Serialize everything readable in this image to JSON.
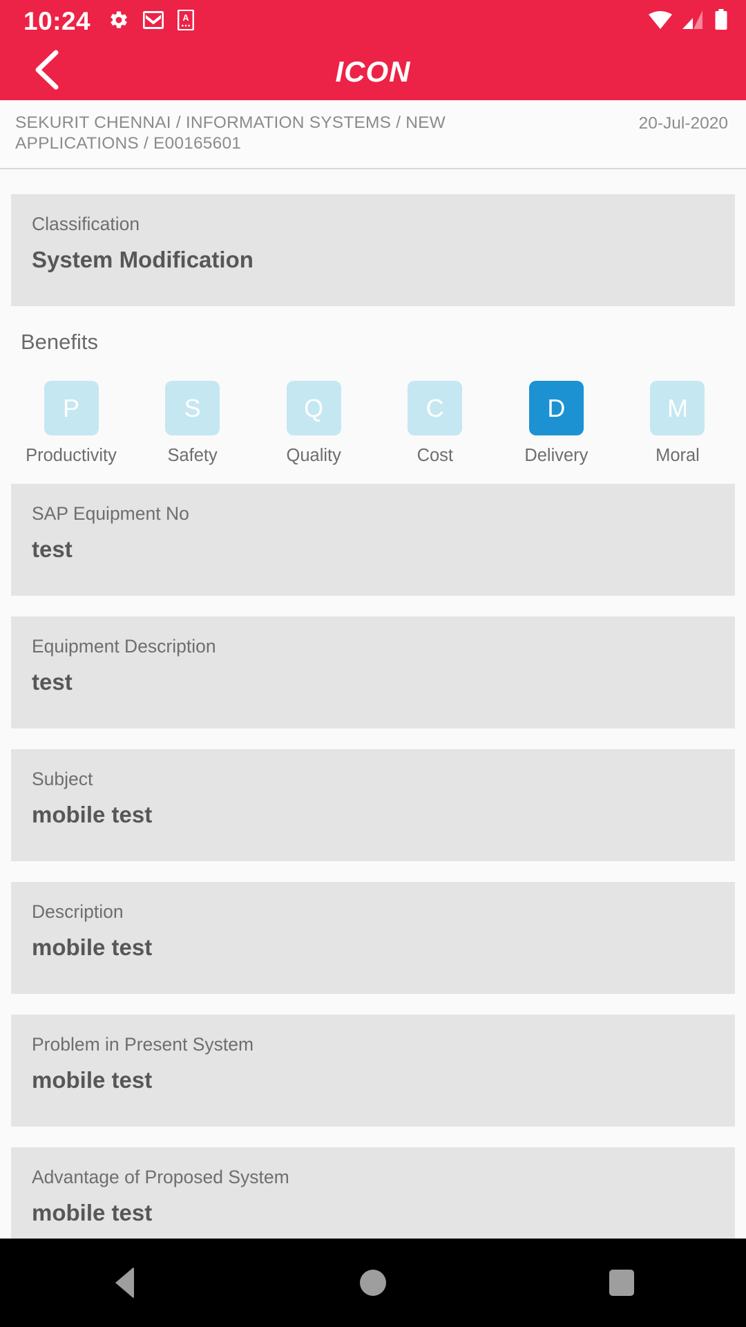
{
  "status_bar": {
    "time": "10:24",
    "left_icons": [
      "gear-icon",
      "gmail-icon",
      "app-a-icon"
    ],
    "right_icons": [
      "wifi-icon",
      "signal-icon",
      "battery-icon"
    ]
  },
  "app_bar": {
    "title": "ICON",
    "back_icon": "chevron-left-icon",
    "background_color": "#ED2247"
  },
  "breadcrumb": {
    "path": "SEKURIT CHENNAI / INFORMATION SYSTEMS  / NEW APPLICATIONS / E00165601",
    "date": "20-Jul-2020"
  },
  "classification": {
    "label": "Classification",
    "value": "System Modification"
  },
  "benefits": {
    "title": "Benefits",
    "selected_color": "#1C92D2",
    "unselected_color": "#C5E7F2",
    "items": [
      {
        "letter": "P",
        "label": "Productivity",
        "selected": false
      },
      {
        "letter": "S",
        "label": "Safety",
        "selected": false
      },
      {
        "letter": "Q",
        "label": "Quality",
        "selected": false
      },
      {
        "letter": "C",
        "label": "Cost",
        "selected": false
      },
      {
        "letter": "D",
        "label": "Delivery",
        "selected": true
      },
      {
        "letter": "M",
        "label": "Moral",
        "selected": false
      }
    ]
  },
  "fields": [
    {
      "label": "SAP Equipment No",
      "value": "test"
    },
    {
      "label": "Equipment Description",
      "value": "test"
    },
    {
      "label": "Subject",
      "value": "mobile test"
    },
    {
      "label": "Description",
      "value": "mobile test"
    },
    {
      "label": "Problem in Present System",
      "value": "mobile test"
    },
    {
      "label": "Advantage of Proposed System",
      "value": "mobile test"
    }
  ],
  "nav_bar": {
    "back_label": "Back",
    "home_label": "Home",
    "recents_label": "Recents"
  }
}
